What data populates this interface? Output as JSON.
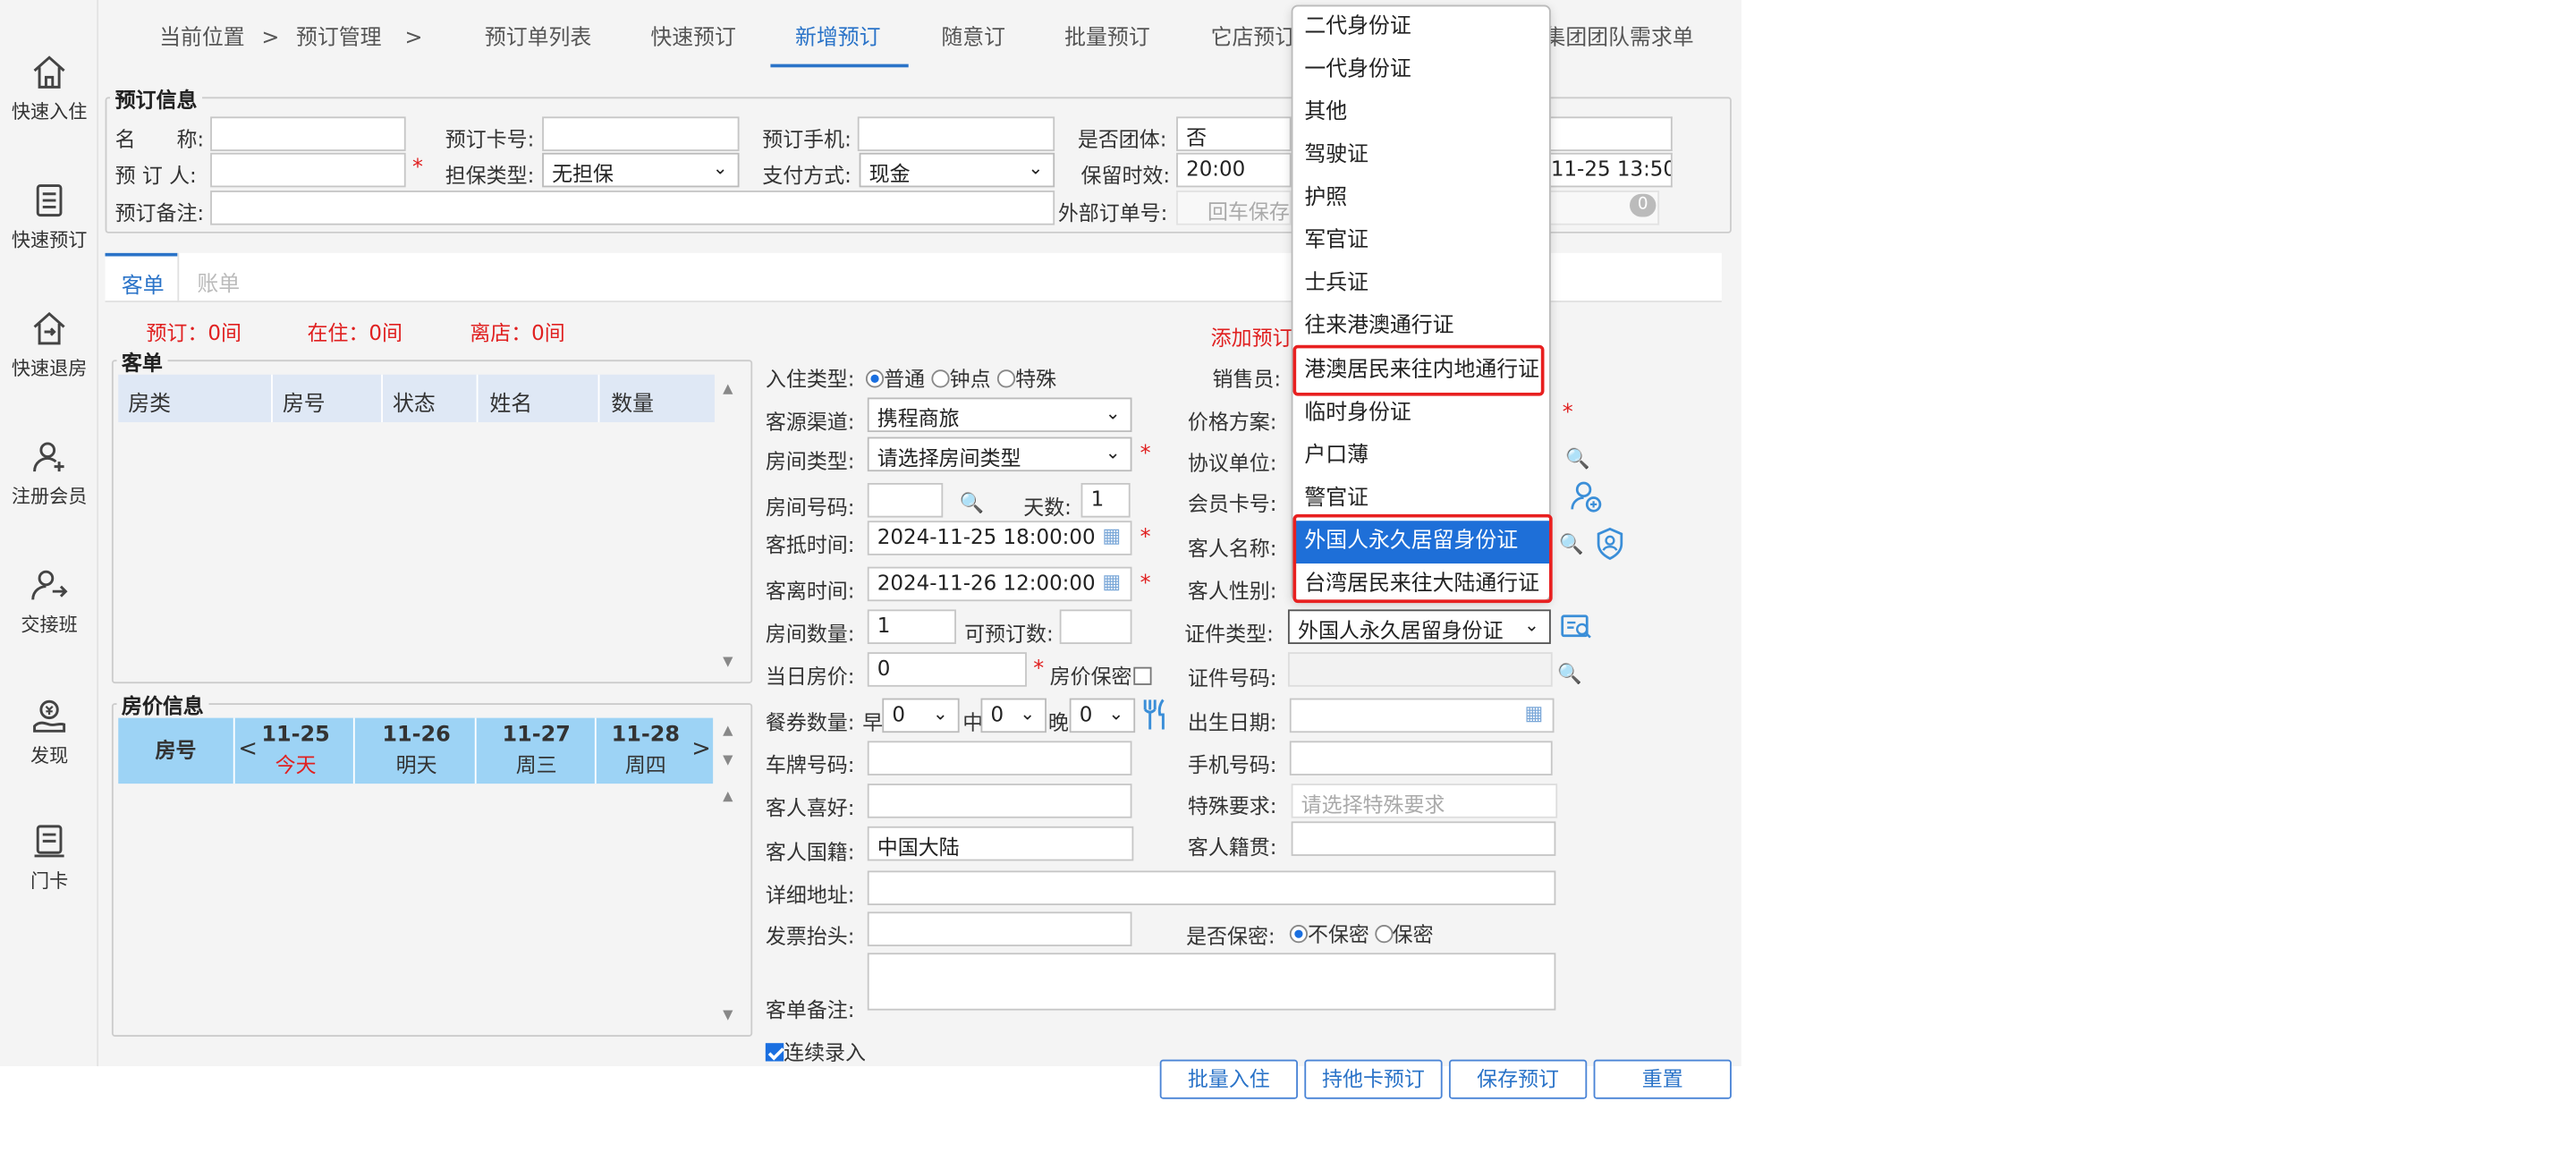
{
  "sidebar": {
    "items": [
      {
        "label": "快速入住",
        "icon": "home-icon"
      },
      {
        "label": "快速预订",
        "icon": "list-icon"
      },
      {
        "label": "快速退房",
        "icon": "checkout-icon"
      },
      {
        "label": "注册会员",
        "icon": "user-add-icon"
      },
      {
        "label": "交接班",
        "icon": "shift-icon"
      },
      {
        "label": "发现",
        "icon": "discover-icon"
      },
      {
        "label": "门卡",
        "icon": "card-icon"
      }
    ]
  },
  "breadcrumb": {
    "current": "当前位置",
    "sep": ">",
    "module": "预订管理",
    "sep2": ">"
  },
  "nav_tabs": [
    "预订单列表",
    "快速预订",
    "新增预订",
    "随意订",
    "批量预订",
    "它店预订",
    "集团团队需求单"
  ],
  "active_nav_tab": "新增预订",
  "booking_info": {
    "legend": "预订信息",
    "name_label": "名　　称:",
    "card_label": "预订卡号:",
    "phone_label": "预订手机:",
    "group_label": "是否团体:",
    "group_value": "否",
    "booker_label": "预 订 人:",
    "guarantee_label": "担保类型:",
    "guarantee_value": "无担保",
    "pay_label": "支付方式:",
    "pay_value": "现金",
    "keep_label": "保留时效:",
    "keep_value": "20:00",
    "datetime_partial": "11-25 13:50:(",
    "note_label": "预订备注:",
    "ext_label": "外部订单号:",
    "ext_placeholder": "回车保存",
    "ext_count": "0"
  },
  "sub_tabs": [
    "客单",
    "账单"
  ],
  "stats": {
    "reserved": "预订：0间",
    "staying": "在住：0间",
    "departed": "离店：0间"
  },
  "add_booking_link": "添加预订",
  "guest_table": {
    "legend": "客单",
    "headers": [
      "房类",
      "房号",
      "状态",
      "姓名",
      "数量"
    ]
  },
  "price_info": {
    "legend": "房价信息",
    "room_col": "房号",
    "days": [
      {
        "date": "11-25",
        "week": "今天"
      },
      {
        "date": "11-26",
        "week": "明天"
      },
      {
        "date": "11-27",
        "week": "周三"
      },
      {
        "date": "11-28",
        "week": "周四"
      }
    ],
    "prev": "<",
    "next": ">"
  },
  "form": {
    "checkin_type_label": "入住类型:",
    "checkin_types": [
      "普通",
      "钟点",
      "特殊"
    ],
    "channel_label": "客源渠道:",
    "channel_value": "携程商旅",
    "room_type_label": "房间类型:",
    "room_type_value": "请选择房间类型",
    "room_no_label": "房间号码:",
    "days_label": "天数:",
    "days_value": "1",
    "arrive_label": "客抵时间:",
    "arrive_value": "2024-11-25 18:00:00",
    "leave_label": "客离时间:",
    "leave_value": "2024-11-26 12:00:00",
    "room_count_label": "房间数量:",
    "room_count_value": "1",
    "available_label": "可预订数:",
    "day_price_label": "当日房价:",
    "day_price_value": "0",
    "price_secret_label": "房价保密",
    "meal_label": "餐券数量:",
    "breakfast": "早",
    "lunch": "中",
    "dinner": "晚",
    "meal_values": [
      "0",
      "0",
      "0"
    ],
    "plate_label": "车牌号码:",
    "pref_label": "客人喜好:",
    "nation_label": "客人国籍:",
    "nation_value": "中国大陆",
    "address_label": "详细地址:",
    "invoice_label": "发票抬头:",
    "guest_note_label": "客单备注:",
    "continuous_label": "连续录入",
    "sales_label": "销售员:",
    "price_plan_label": "价格方案:",
    "agreement_label": "协议单位:",
    "member_label": "会员卡号:",
    "guest_name_label": "客人名称:",
    "gender_label": "客人性别:",
    "id_type_label": "证件类型:",
    "id_type_value": "外国人永久居留身份证",
    "id_no_label": "证件号码:",
    "birth_label": "出生日期:",
    "mobile_label": "手机号码:",
    "special_label": "特殊要求:",
    "special_placeholder": "请选择特殊要求",
    "origin_label": "客人籍贯:",
    "secret_label": "是否保密:",
    "secret_options": [
      "不保密",
      "保密"
    ]
  },
  "id_dropdown": {
    "options": [
      "二代身份证",
      "一代身份证",
      "其他",
      "驾驶证",
      "护照",
      "军官证",
      "士兵证",
      "往来港澳通行证",
      "港澳居民来往内地通行证",
      "临时身份证",
      "户口薄",
      "警官证",
      "外国人永久居留身份证",
      "台湾居民来往大陆通行证"
    ],
    "selected": "外国人永久居留身份证"
  },
  "buttons": {
    "batch_checkin": "批量入住",
    "other_card": "持他卡预订",
    "save": "保存预订",
    "reset": "重置"
  },
  "colors": {
    "accent": "#2a73c8",
    "required": "#e02020",
    "highlight_box": "#e82020",
    "selected_option": "#1e6fd8",
    "price_header": "#9dd3f5"
  }
}
